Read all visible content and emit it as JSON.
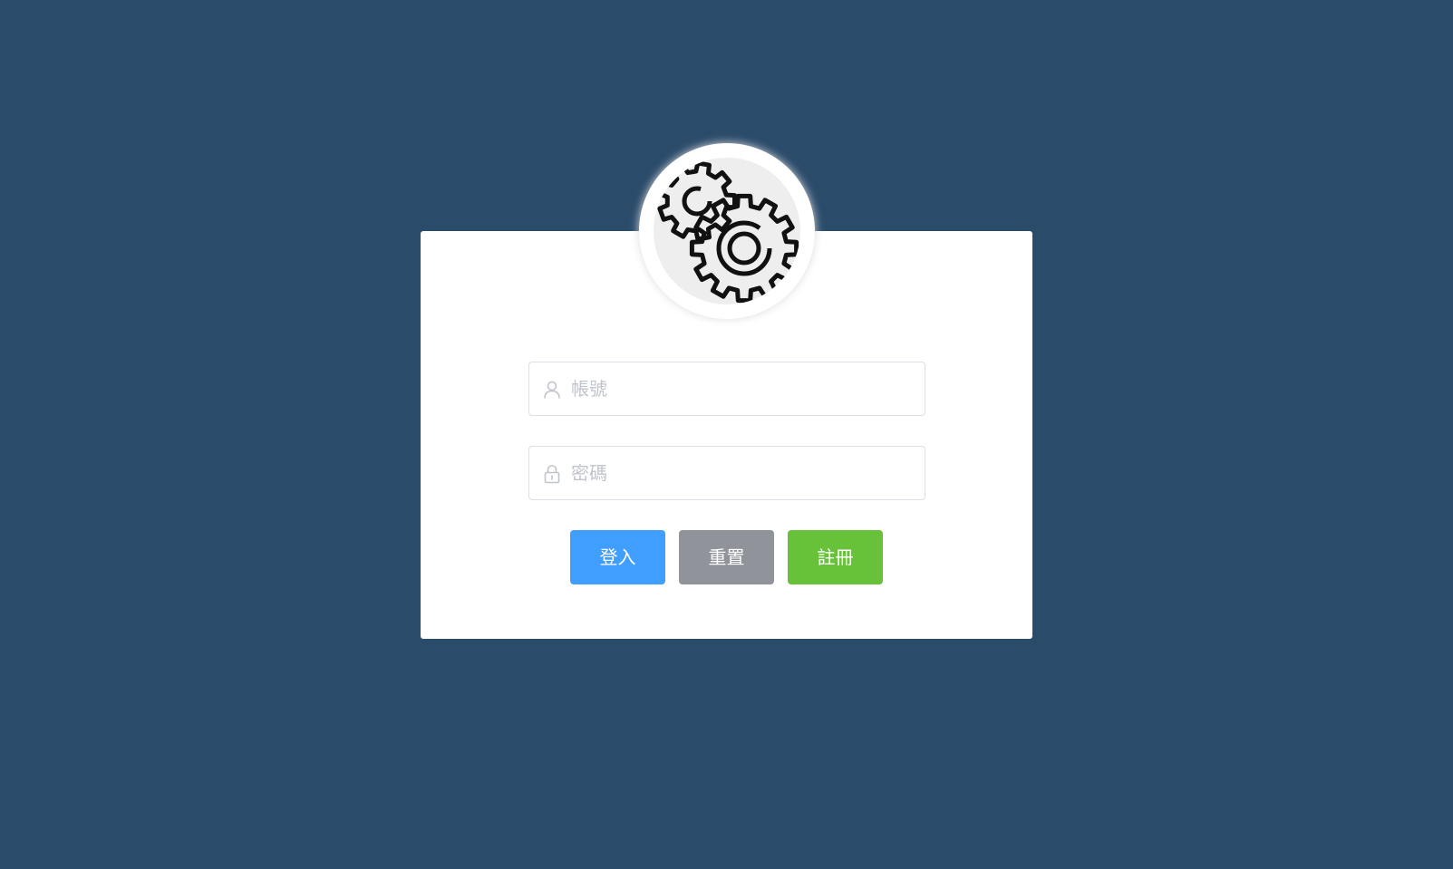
{
  "avatar": {
    "icon": "gears-icon"
  },
  "login_form": {
    "username": {
      "value": "",
      "placeholder": "帳號",
      "icon": "user-icon"
    },
    "password": {
      "value": "",
      "placeholder": "密碼",
      "icon": "lock-icon"
    },
    "buttons": {
      "login_label": "登入",
      "reset_label": "重置",
      "register_label": "註冊"
    }
  },
  "colors": {
    "background": "#2b4b6b",
    "primary": "#409eff",
    "info": "#909399",
    "success": "#67c23a",
    "border": "#dcdfe6",
    "placeholder": "#c0c4cc"
  }
}
